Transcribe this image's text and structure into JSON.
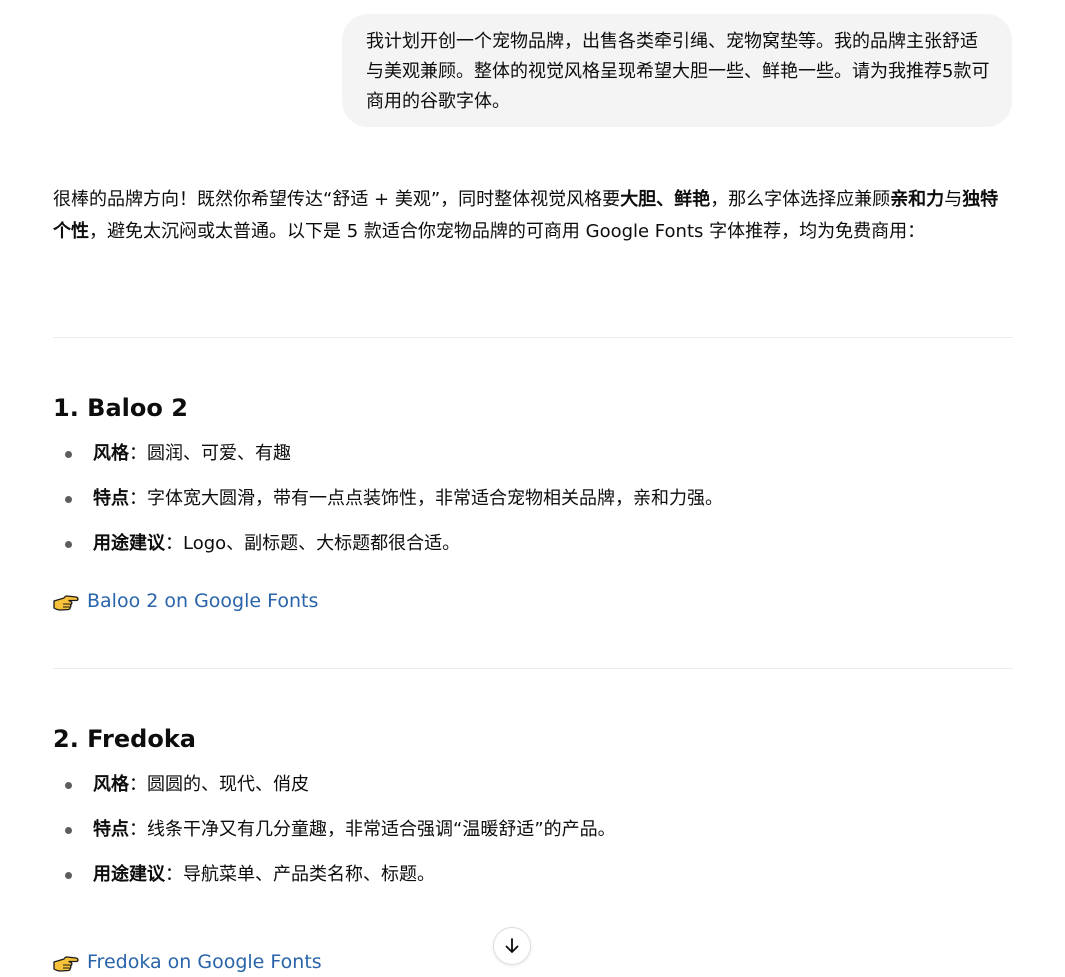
{
  "user_message": "我计划开创一个宠物品牌，出售各类牵引绳、宠物窝垫等。我的品牌主张舒适与美观兼顾。整体的视觉风格呈现希望大胆一些、鲜艳一些。请为我推荐5款可商用的谷歌字体。",
  "assistant": {
    "intro": {
      "p1": "很棒的品牌方向！既然你希望传达“舒适 + 美观”，同时整体视觉风格要",
      "b1": "大胆、鲜艳",
      "p2": "，那么字体选择应兼顾",
      "b2": "亲和力",
      "p3": "与",
      "b3": "独特个性",
      "p4": "，避免太沉闷或太普通。以下是 5 款适合你宠物品牌的可商用 Google Fonts 字体推荐，均为免费商用："
    },
    "fonts": [
      {
        "title": "1. Baloo 2",
        "bullets": [
          {
            "key": "风格",
            "sep": "：",
            "value": "圆润、可爱、有趣"
          },
          {
            "key": "特点",
            "sep": "：",
            "value": "字体宽大圆滑，带有一点点装饰性，非常适合宠物相关品牌，亲和力强。"
          },
          {
            "key": "用途建议",
            "sep": "：",
            "value": "Logo、副标题、大标题都很合适。"
          }
        ],
        "link_text": "Baloo 2 on Google Fonts"
      },
      {
        "title": "2. Fredoka",
        "bullets": [
          {
            "key": "风格",
            "sep": "：",
            "value": "圆圆的、现代、俏皮"
          },
          {
            "key": "特点",
            "sep": "：",
            "value": "线条干净又有几分童趣，非常适合强调“温暖舒适”的产品。"
          },
          {
            "key": "用途建议",
            "sep": "：",
            "value": "导航菜单、产品类名称、标题。"
          }
        ],
        "link_text": "Fredoka on Google Fonts"
      }
    ]
  },
  "colors": {
    "link": "#2964aa",
    "bubble_bg": "#f4f4f4",
    "text": "#0d0d0d"
  },
  "icons": {
    "pointer": "hand-pointing-right-icon",
    "scroll": "arrow-down-icon"
  }
}
